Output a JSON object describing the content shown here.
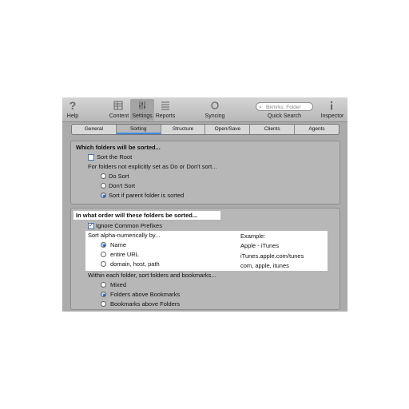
{
  "toolbar": {
    "help": "Help",
    "content": "Content",
    "settings": "Settings",
    "reports": "Reports",
    "syncing": "Syncing",
    "search_placeholder": "Bkmrks, Folder",
    "quick_search": "Quick Search",
    "inspector": "Inspector",
    "icons": [
      "help-icon",
      "content-icon",
      "settings-icon",
      "reports-icon",
      "syncing-icon",
      "inspector-icon"
    ]
  },
  "tabs": [
    "General",
    "Sorting",
    "Structure",
    "Open/Save",
    "Clients",
    "Agents"
  ],
  "active_tab": "Sorting",
  "section1": {
    "title": "Which folders will be sorted...",
    "sort_root": "Sort the Root",
    "sort_root_checked": false,
    "explain": "For folders not explicitly set as Do or Don't sort...",
    "options": [
      "Do Sort",
      "Don't Sort",
      "Sort if parent folder is sorted"
    ],
    "selected": 2
  },
  "section2": {
    "title": "In what order will these folders be sorted...",
    "ignore_prefixes": "Ignore Common Prefixes",
    "ignore_checked": true,
    "sort_by_label": "Sort alpha-numerically by...",
    "example_label": "Example:",
    "sort_options": [
      {
        "label": "Name",
        "example": "Apple - iTunes"
      },
      {
        "label": "entire URL",
        "example": "iTunes.apple.com/tunes"
      },
      {
        "label": "domain, host, path",
        "example": "com, apple, itunes"
      }
    ],
    "sort_selected": 0,
    "within_label": "Within each folder, sort folders and bookmarks...",
    "within_options": [
      "Mixed",
      "Folders above Bookmarks",
      "Bookmarks above Folders"
    ],
    "within_selected": 1
  },
  "colors": {
    "accent": "#3a8be0",
    "window_bg": "#ababab"
  }
}
